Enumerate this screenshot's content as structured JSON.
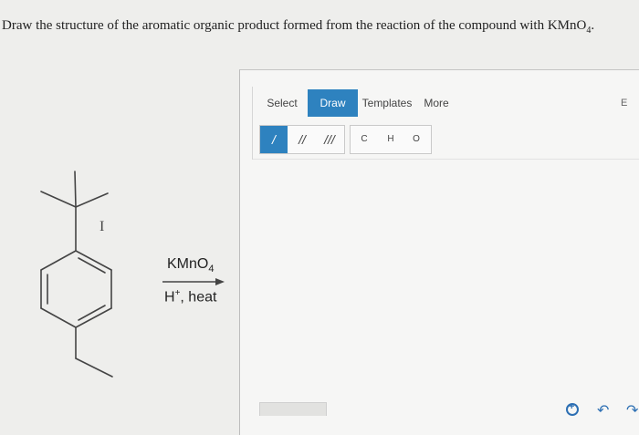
{
  "question": {
    "text": "Draw the structure of the aromatic organic product formed from the reaction of the compound with KMnO",
    "subscript": "4",
    "end": "."
  },
  "reaction": {
    "reagent_top": "KMnO",
    "reagent_top_sub": "4",
    "reagent_bottom_prefix": "H",
    "reagent_bottom_sup": "+",
    "reagent_bottom_suffix": ", heat"
  },
  "molecule": {
    "label": "I"
  },
  "editor": {
    "tabs": [
      {
        "label": "Select",
        "active": false
      },
      {
        "label": "Draw",
        "active": true
      },
      {
        "label": "Templates",
        "active": false
      },
      {
        "label": "More",
        "active": false
      }
    ],
    "edge_label": "E",
    "bond_tools": [
      {
        "label": "/",
        "active": true
      },
      {
        "label": "//",
        "active": false
      },
      {
        "label": "///",
        "active": false
      }
    ],
    "atom_tools": [
      "C",
      "H",
      "O"
    ]
  },
  "colors": {
    "accent": "#2e82bf",
    "background": "#eeeeec"
  }
}
